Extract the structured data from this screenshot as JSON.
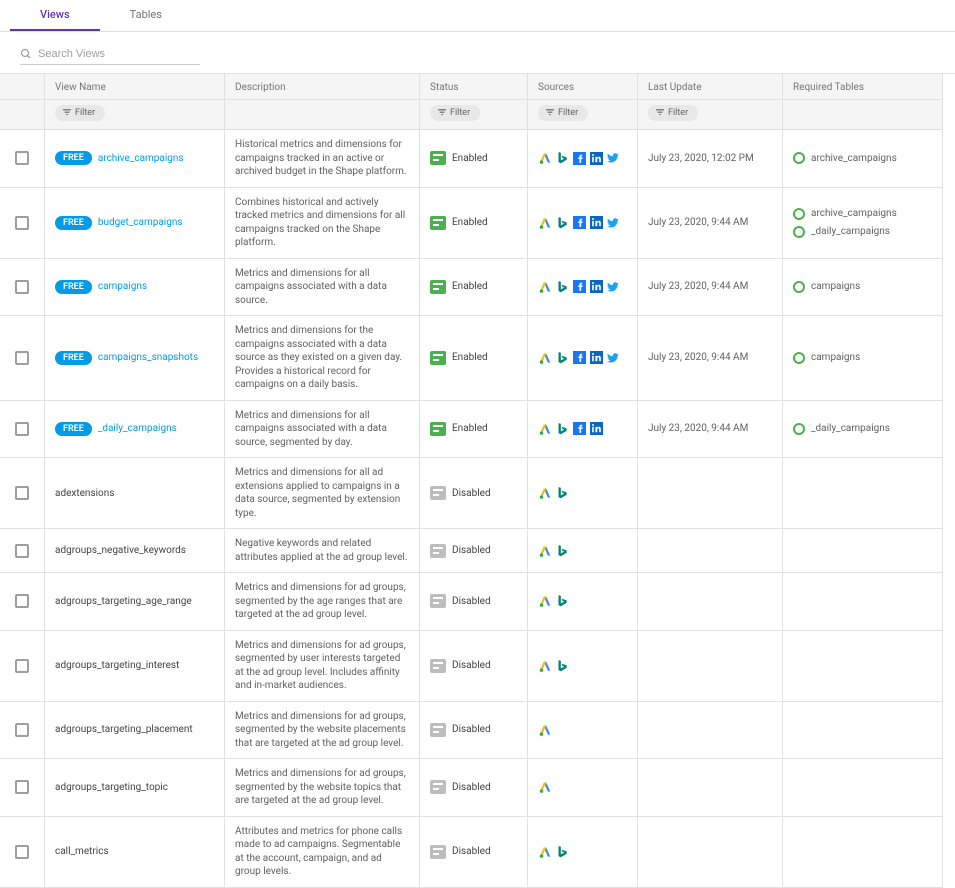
{
  "tabs": {
    "views": "Views",
    "tables": "Tables"
  },
  "search": {
    "placeholder": "Search Views"
  },
  "columns": {
    "viewName": "View Name",
    "description": "Description",
    "status": "Status",
    "sources": "Sources",
    "lastUpdate": "Last Update",
    "requiredTables": "Required Tables"
  },
  "filterLabel": "Filter",
  "freeLabel": "FREE",
  "statusLabels": {
    "enabled": "Enabled",
    "disabled": "Disabled"
  },
  "rows": [
    {
      "free": true,
      "name": "archive_campaigns",
      "desc": "Historical metrics and dimensions for campaigns tracked in an active or archived budget in the Shape platform.",
      "enabled": true,
      "sources": [
        "adwords",
        "bing",
        "facebook",
        "linkedin",
        "twitter"
      ],
      "updated": "July 23, 2020, 12:02 PM",
      "required": [
        "archive_campaigns"
      ]
    },
    {
      "free": true,
      "name": "budget_campaigns",
      "desc": "Combines historical and actively tracked metrics and dimensions for all campaigns tracked on the Shape platform.",
      "enabled": true,
      "sources": [
        "adwords",
        "bing",
        "facebook",
        "linkedin",
        "twitter"
      ],
      "updated": "July 23, 2020, 9:44 AM",
      "required": [
        "archive_campaigns",
        "_daily_campaigns"
      ]
    },
    {
      "free": true,
      "name": "campaigns",
      "desc": "Metrics and dimensions for all campaigns associated with a data source.",
      "enabled": true,
      "sources": [
        "adwords",
        "bing",
        "facebook",
        "linkedin",
        "twitter"
      ],
      "updated": "July 23, 2020, 9:44 AM",
      "required": [
        "campaigns"
      ]
    },
    {
      "free": true,
      "name": "campaigns_snapshots",
      "desc": "Metrics and dimensions for the campaigns associated with a data source as they existed on a given day. Provides a historical record for campaigns on a daily basis.",
      "enabled": true,
      "sources": [
        "adwords",
        "bing",
        "facebook",
        "linkedin",
        "twitter"
      ],
      "updated": "July 23, 2020, 9:44 AM",
      "required": [
        "campaigns"
      ]
    },
    {
      "free": true,
      "name": "_daily_campaigns",
      "desc": "Metrics and dimensions for all campaigns associated with a data source, segmented by day.",
      "enabled": true,
      "sources": [
        "adwords",
        "bing",
        "facebook",
        "linkedin"
      ],
      "updated": "July 23, 2020, 9:44 AM",
      "required": [
        "_daily_campaigns"
      ]
    },
    {
      "free": false,
      "name": "adextensions",
      "desc": "Metrics and dimensions for all ad extensions applied to campaigns in a data source, segmented by extension type.",
      "enabled": false,
      "sources": [
        "adwords",
        "bing"
      ],
      "updated": "",
      "required": []
    },
    {
      "free": false,
      "name": "adgroups_negative_keywords",
      "desc": "Negative keywords and related attributes applied at the ad group level.",
      "enabled": false,
      "sources": [
        "adwords",
        "bing"
      ],
      "updated": "",
      "required": []
    },
    {
      "free": false,
      "name": "adgroups_targeting_age_range",
      "desc": "Metrics and dimensions for ad groups, segmented by the age ranges that are targeted at the ad group level.",
      "enabled": false,
      "sources": [
        "adwords",
        "bing"
      ],
      "updated": "",
      "required": []
    },
    {
      "free": false,
      "name": "adgroups_targeting_interest",
      "desc": "Metrics and dimensions for ad groups, segmented by user interests targeted at the ad group level. Includes affinity and in-market audiences.",
      "enabled": false,
      "sources": [
        "adwords",
        "bing"
      ],
      "updated": "",
      "required": []
    },
    {
      "free": false,
      "name": "adgroups_targeting_placement",
      "desc": "Metrics and dimensions for ad groups, segmented by the website placements that are targeted at the ad group level.",
      "enabled": false,
      "sources": [
        "adwords"
      ],
      "updated": "",
      "required": []
    },
    {
      "free": false,
      "name": "adgroups_targeting_topic",
      "desc": "Metrics and dimensions for ad groups, segmented by the website topics that are targeted at the ad group level.",
      "enabled": false,
      "sources": [
        "adwords"
      ],
      "updated": "",
      "required": []
    },
    {
      "free": false,
      "name": "call_metrics",
      "desc": "Attributes and metrics for phone calls made to ad campaigns. Segmentable at the account, campaign, and ad group levels.",
      "enabled": false,
      "sources": [
        "adwords",
        "bing"
      ],
      "updated": "",
      "required": []
    }
  ]
}
